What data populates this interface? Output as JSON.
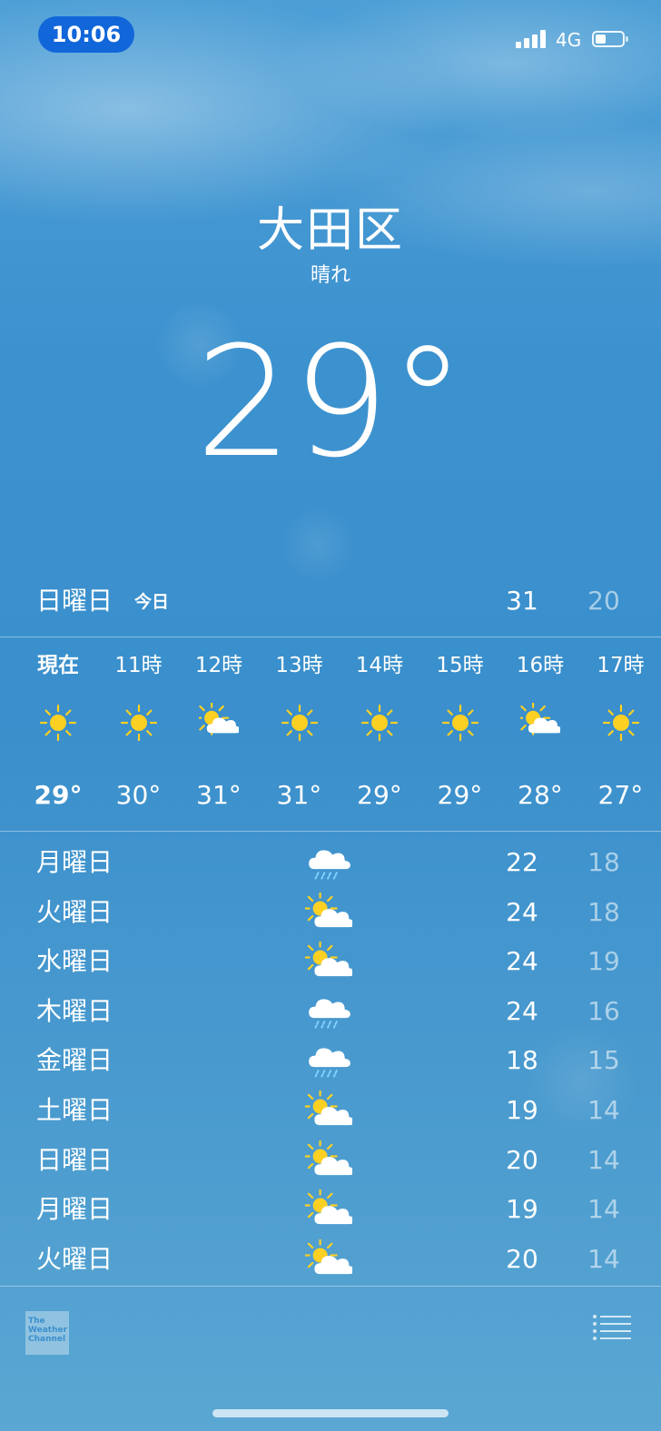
{
  "status_bar": {
    "time": "10:06",
    "network": "4G",
    "battery_level": 0.4,
    "signal_bars": 4
  },
  "location": {
    "city": "大田区",
    "condition": "晴れ",
    "current_temp": "29°"
  },
  "today": {
    "day": "日曜日",
    "label": "今日",
    "high": "31",
    "low": "20"
  },
  "hourly": [
    {
      "time": "現在",
      "icon": "sun-icon",
      "temp": "29°"
    },
    {
      "time": "11時",
      "icon": "sun-icon",
      "temp": "30°"
    },
    {
      "time": "12時",
      "icon": "partly-cloudy-icon",
      "temp": "31°"
    },
    {
      "time": "13時",
      "icon": "sun-icon",
      "temp": "31°"
    },
    {
      "time": "14時",
      "icon": "sun-icon",
      "temp": "29°"
    },
    {
      "time": "15時",
      "icon": "sun-icon",
      "temp": "29°"
    },
    {
      "time": "16時",
      "icon": "partly-cloudy-icon",
      "temp": "28°"
    },
    {
      "time": "17時",
      "icon": "sun-icon",
      "temp": "27°"
    }
  ],
  "daily": [
    {
      "day": "月曜日",
      "icon": "rain-cloud-icon",
      "high": "22",
      "low": "18"
    },
    {
      "day": "火曜日",
      "icon": "partly-cloudy-icon",
      "high": "24",
      "low": "18"
    },
    {
      "day": "水曜日",
      "icon": "partly-cloudy-icon",
      "high": "24",
      "low": "19"
    },
    {
      "day": "木曜日",
      "icon": "rain-cloud-icon",
      "high": "24",
      "low": "16"
    },
    {
      "day": "金曜日",
      "icon": "rain-cloud-icon",
      "high": "18",
      "low": "15"
    },
    {
      "day": "土曜日",
      "icon": "partly-cloudy-icon",
      "high": "19",
      "low": "14"
    },
    {
      "day": "日曜日",
      "icon": "partly-cloudy-icon",
      "high": "20",
      "low": "14"
    },
    {
      "day": "月曜日",
      "icon": "partly-cloudy-icon",
      "high": "19",
      "low": "14"
    },
    {
      "day": "火曜日",
      "icon": "partly-cloudy-icon",
      "high": "20",
      "low": "14"
    }
  ],
  "footer": {
    "logo_line1": "The",
    "logo_line2": "Weather",
    "logo_line3": "Channel",
    "list_icon": "list-icon"
  },
  "colors": {
    "sun": "#fcd023",
    "rain": "#7fd3ff",
    "time_pill": "#1166d9"
  }
}
